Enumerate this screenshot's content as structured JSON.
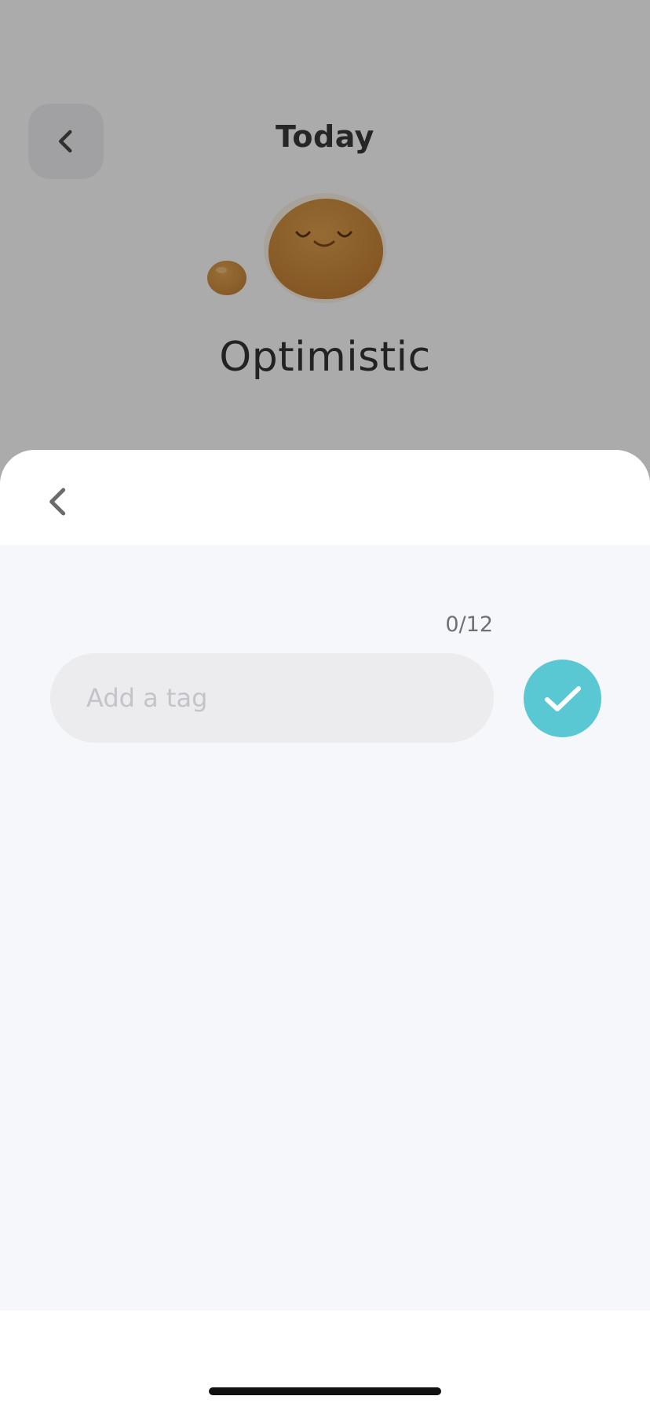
{
  "background": {
    "title": "Today",
    "mood_label": "Optimistic",
    "icons": {
      "back": "chevron-left-icon",
      "mood": "mood-blob-icon"
    },
    "colors": {
      "mood_blob": "#c98a3e"
    }
  },
  "sheet": {
    "counter": "0/12",
    "input": {
      "value": "",
      "placeholder": "Add a tag"
    },
    "icons": {
      "back": "chevron-left-icon",
      "confirm": "checkmark-icon"
    },
    "colors": {
      "confirm_button": "#5ac8d2",
      "body_bg": "#f5f7fb",
      "input_bg": "#ececef"
    }
  }
}
